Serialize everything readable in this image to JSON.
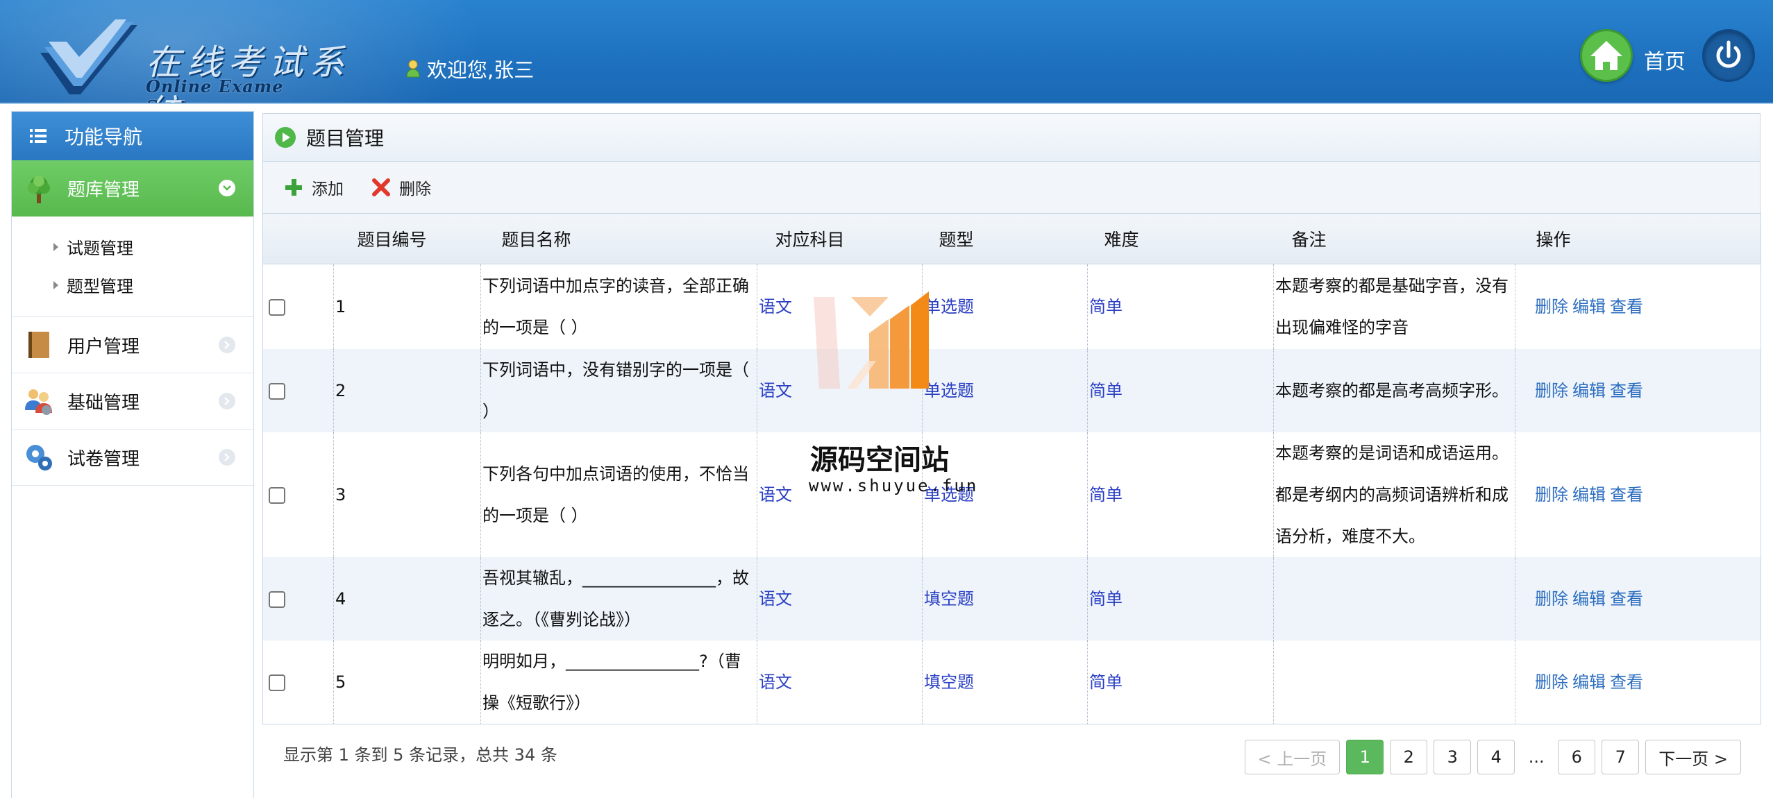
{
  "header": {
    "logo_cn": "在线考试系统",
    "logo_en": "Online Exame System",
    "welcome": "欢迎您,张三",
    "home_label": "首页"
  },
  "sidebar": {
    "title": "功能导航",
    "groups": [
      {
        "label": "题库管理",
        "icon": "tree-icon",
        "expanded": true
      },
      {
        "label": "用户管理",
        "icon": "book-icon",
        "expanded": false
      },
      {
        "label": "基础管理",
        "icon": "users-icon",
        "expanded": false
      },
      {
        "label": "试卷管理",
        "icon": "gears-icon",
        "expanded": false
      }
    ],
    "sub_items": [
      "试题管理",
      "题型管理"
    ]
  },
  "panel": {
    "title": "题目管理",
    "toolbar": {
      "add": "添加",
      "delete": "删除"
    }
  },
  "table": {
    "columns": [
      "",
      "题目编号",
      "题目名称",
      "对应科目",
      "题型",
      "难度",
      "备注",
      "操作"
    ],
    "rows": [
      {
        "id": "1",
        "name": "下列词语中加点字的读音，全部正确的一项是（ ）",
        "subject": "语文",
        "type": "单选题",
        "difficulty": "简单",
        "note": "本题考察的都是基础字音，没有出现偏难怪的字音"
      },
      {
        "id": "2",
        "name": "下列词语中，没有错别字的一项是（ ）",
        "subject": "语文",
        "type": "单选题",
        "difficulty": "简单",
        "note": "本题考察的都是高考高频字形。"
      },
      {
        "id": "3",
        "name": "下列各句中加点词语的使用，不恰当的一项是（ ）",
        "subject": "语文",
        "type": "单选题",
        "difficulty": "简单",
        "note": "本题考察的是词语和成语运用。都是考纲内的高频词语辨析和成语分析，难度不大。"
      },
      {
        "id": "4",
        "name": "吾视其辙乱，________________，故逐之。（《曹刿论战》）",
        "subject": "语文",
        "type": "填空题",
        "difficulty": "简单",
        "note": ""
      },
      {
        "id": "5",
        "name": "明明如月，________________?（曹操《短歌行》）",
        "subject": "语文",
        "type": "填空题",
        "difficulty": "简单",
        "note": ""
      }
    ],
    "ops": {
      "delete": "删除",
      "edit": "编辑",
      "view": "查看"
    }
  },
  "footer": {
    "summary": "显示第 1 条到 5 条记录，总共 34 条",
    "prev": "< 上一页",
    "next": "下一页 >",
    "pages": [
      "1",
      "2",
      "3",
      "4",
      "...",
      "6",
      "7"
    ],
    "current_page": "1"
  },
  "watermark": {
    "cn": "源码空间站",
    "en": "www.shuyue.fun"
  },
  "colors": {
    "header_blue": "#1e72c0",
    "active_green": "#58b94e",
    "link_blue": "#2a3fc4",
    "op_blue": "#2c6dc0",
    "pager_green": "#5cb85c"
  }
}
